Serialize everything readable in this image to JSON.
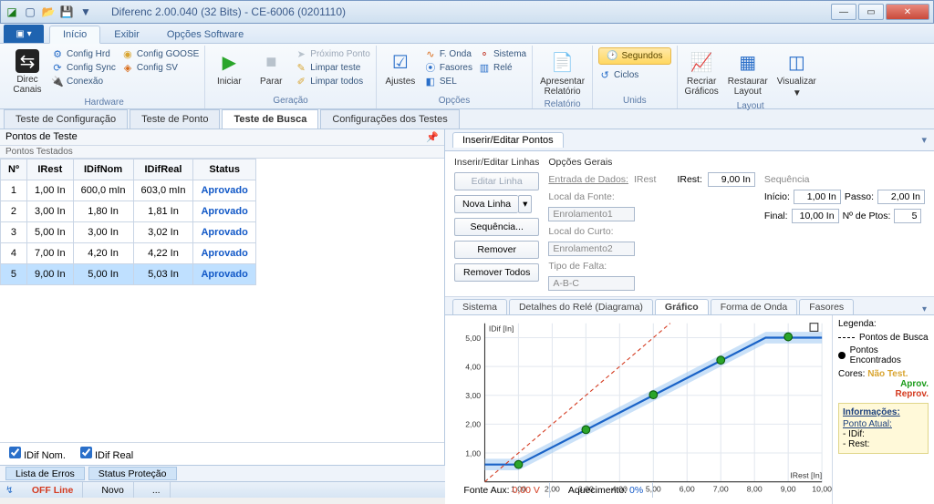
{
  "window": {
    "title": "Diferenc 2.00.040 (32 Bits) - CE-6006 (0201110)"
  },
  "menu": {
    "tabs": [
      "Início",
      "Exibir",
      "Opções Software"
    ],
    "active": 0
  },
  "ribbon": {
    "groups": {
      "hardware": {
        "label": "Hardware",
        "direc_canais": "Direc\nCanais",
        "items": [
          "Config Hrd",
          "Config GOOSE",
          "Config Sync",
          "Config SV",
          "Conexão"
        ]
      },
      "geracao": {
        "label": "Geração",
        "iniciar": "Iniciar",
        "parar": "Parar",
        "items": [
          "Próximo Ponto",
          "Limpar teste",
          "Limpar todos"
        ]
      },
      "opcoes": {
        "label": "Opções",
        "ajustes": "Ajustes",
        "items": [
          "F. Onda",
          "Sistema",
          "Fasores",
          "Relé",
          "SEL"
        ]
      },
      "relatorio": {
        "label": "Relatório",
        "btn": "Apresentar\nRelatório"
      },
      "unids": {
        "label": "Unids",
        "segundos": "Segundos",
        "ciclos": "Ciclos"
      },
      "layout": {
        "label": "Layout",
        "recriar": "Recriar\nGráficos",
        "restaurar": "Restaurar\nLayout",
        "visualizar": "Visualizar"
      }
    }
  },
  "sec_tabs": {
    "items": [
      "Teste de Configuração",
      "Teste de Ponto",
      "Teste de Busca",
      "Configurações dos Testes"
    ],
    "active": 2
  },
  "left": {
    "title": "Pontos de Teste",
    "subtitle": "Pontos Testados",
    "columns": [
      "Nº",
      "IRest",
      "IDifNom",
      "IDifReal",
      "Status"
    ],
    "rows": [
      {
        "n": "1",
        "irest": "1,00 In",
        "idifnom": "600,0 mIn",
        "idifreal": "603,0 mIn",
        "status": "Aprovado"
      },
      {
        "n": "2",
        "irest": "3,00 In",
        "idifnom": "1,80 In",
        "idifreal": "1,81 In",
        "status": "Aprovado"
      },
      {
        "n": "3",
        "irest": "5,00 In",
        "idifnom": "3,00 In",
        "idifreal": "3,02 In",
        "status": "Aprovado"
      },
      {
        "n": "4",
        "irest": "7,00 In",
        "idifnom": "4,20 In",
        "idifreal": "4,22 In",
        "status": "Aprovado"
      },
      {
        "n": "5",
        "irest": "9,00 In",
        "idifnom": "5,00 In",
        "idifreal": "5,03 In",
        "status": "Aprovado"
      }
    ],
    "chk1": "IDif Nom.",
    "chk2": "IDif Real"
  },
  "right": {
    "ins_edit_title": "Inserir/Editar Pontos",
    "ins_edit_linhas": "Inserir/Editar Linhas",
    "opcoes_gerais": "Opções Gerais",
    "entrada_dados": "Entrada de Dados:",
    "entrada_tipo": "IRest",
    "irest_label": "IRest:",
    "irest_value": "9,00 In",
    "buttons": {
      "editar": "Editar Linha",
      "nova": "Nova Linha",
      "seq": "Sequência...",
      "remover": "Remover",
      "remover_todos": "Remover Todos"
    },
    "local_fonte_lbl": "Local da Fonte:",
    "local_fonte": "Enrolamento1",
    "local_curto_lbl": "Local do Curto:",
    "local_curto": "Enrolamento2",
    "tipo_falta_lbl": "Tipo de Falta:",
    "tipo_falta": "A-B-C",
    "seq_lbl": "Sequência",
    "inicio_lbl": "Início:",
    "inicio": "1,00 In",
    "passo_lbl": "Passo:",
    "passo": "2,00 In",
    "final_lbl": "Final:",
    "final": "10,00 In",
    "nptos_lbl": "Nº de Ptos:",
    "nptos": "5",
    "gtabs": [
      "Sistema",
      "Detalhes do Relé (Diagrama)",
      "Gráfico",
      "Forma de Onda",
      "Fasores"
    ],
    "gtab_active": 2,
    "legend": {
      "title": "Legenda:",
      "busca": "Pontos de Busca",
      "enc": "Pontos Encontrados",
      "cores": "Cores:",
      "nao": "Não Test.",
      "aprov": "Aprov.",
      "reprov": "Reprov.",
      "info_title": "Informações:",
      "ponto_atual": "Ponto Atual:",
      "idif": "- IDif:",
      "rest": "- Rest:"
    },
    "chart": {
      "ylabel": "IDif [In]",
      "xlabel": "IRest [In]"
    }
  },
  "chart_data": {
    "type": "line",
    "xlabel": "IRest [In]",
    "ylabel": "IDif [In]",
    "xlim": [
      0,
      10
    ],
    "ylim": [
      0,
      5.5
    ],
    "xticks": [
      "1,00",
      "2,00",
      "3,00",
      "4,00",
      "5,00",
      "6,00",
      "7,00",
      "8,00",
      "9,00",
      "10,00"
    ],
    "yticks": [
      "1,00",
      "2,00",
      "3,00",
      "4,00",
      "5,00"
    ],
    "series": [
      {
        "name": "nom_curve_blue",
        "x": [
          0,
          1,
          8.33,
          10
        ],
        "y": [
          0.6,
          0.6,
          5.0,
          5.0
        ]
      },
      {
        "name": "red_dashed_ref",
        "x": [
          0,
          5.5
        ],
        "y": [
          0,
          5.5
        ]
      }
    ],
    "points_found": [
      {
        "x": 1.0,
        "y": 0.6
      },
      {
        "x": 3.0,
        "y": 1.81
      },
      {
        "x": 5.0,
        "y": 3.02
      },
      {
        "x": 7.0,
        "y": 4.22
      },
      {
        "x": 9.0,
        "y": 5.03
      }
    ]
  },
  "bottom_tabs": [
    "Lista de Erros",
    "Status Proteção"
  ],
  "status": {
    "off": "OFF Line",
    "novo": "Novo",
    "dots": "...",
    "fonte_aux_lbl": "Fonte Aux:",
    "fonte_aux": "0,00 V",
    "aquec_lbl": "Aquecimento:",
    "aquec": "0%"
  }
}
